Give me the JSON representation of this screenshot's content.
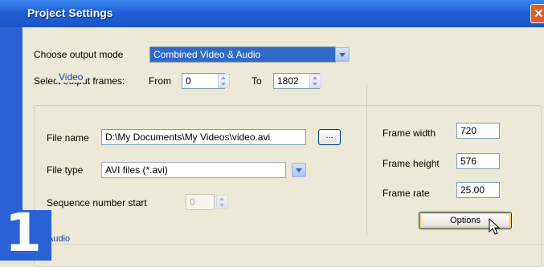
{
  "window": {
    "title": "Project Settings"
  },
  "output": {
    "mode_label": "Choose output mode",
    "mode_value": "Combined Video & Audio",
    "frames_label": "Select output frames:",
    "from_label": "From",
    "from_value": "0",
    "to_label": "To",
    "to_value": "1802"
  },
  "video": {
    "group_label": "Video",
    "file_name_label": "File name",
    "file_name_value": "D:\\My Documents\\My Videos\\video.avi",
    "browse_label": "...",
    "file_type_label": "File type",
    "file_type_value": "AVI files (*.avi)",
    "sequence_label": "Sequence number start",
    "sequence_value": "0",
    "frame_width_label": "Frame width",
    "frame_width_value": "720",
    "frame_height_label": "Frame height",
    "frame_height_value": "576",
    "frame_rate_label": "Frame rate",
    "frame_rate_value": "25.00",
    "options_label": "Options"
  },
  "audio": {
    "group_label": "Audio"
  },
  "overlay": {
    "step_number": "1"
  }
}
